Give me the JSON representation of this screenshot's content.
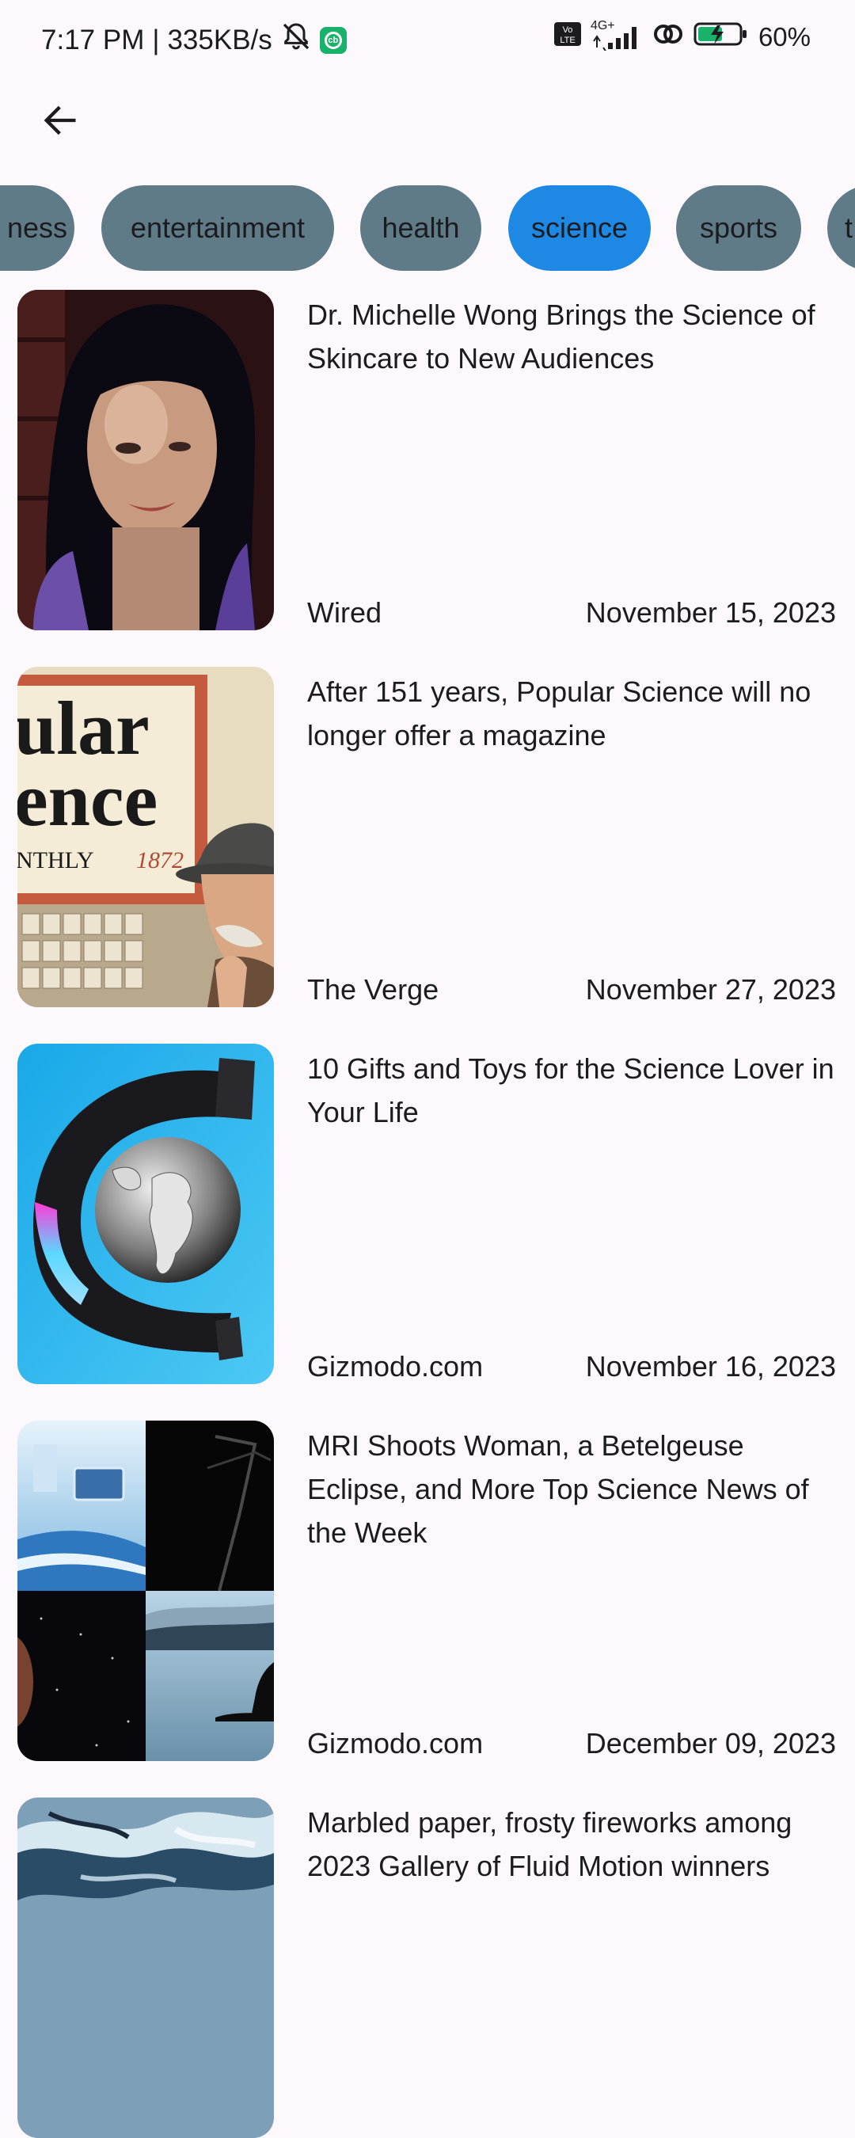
{
  "status_bar": {
    "time": "7:17 PM",
    "speed": "335KB/s",
    "network": "4G+",
    "battery": "60%",
    "app_badge": "cb"
  },
  "icons": {
    "back": "arrow-left-icon",
    "mute": "bell-off-icon",
    "volte": "volte-icon",
    "signal": "signal-icon",
    "hotspot": "link-icon",
    "battery": "battery-charging-icon"
  },
  "categories": [
    {
      "label": "business",
      "visible": "ness",
      "selected": false
    },
    {
      "label": "entertainment",
      "visible": "entertainment",
      "selected": false
    },
    {
      "label": "health",
      "visible": "health",
      "selected": false
    },
    {
      "label": "science",
      "visible": "science",
      "selected": true
    },
    {
      "label": "sports",
      "visible": "sports",
      "selected": false
    },
    {
      "label": "technology",
      "visible": "t",
      "selected": false
    }
  ],
  "articles": [
    {
      "title": "Dr. Michelle Wong Brings the Science of Skincare to New Audiences",
      "source": "Wired",
      "date": "November 15, 2023",
      "image": "portrait-woman-purple-hair"
    },
    {
      "title": "After 151 years, Popular Science will no longer offer a magazine",
      "source": "The Verge",
      "date": "November 27, 2023",
      "image": "popular-science-cover",
      "image_text": [
        "ular",
        "ence",
        "NTHLY",
        "1872"
      ]
    },
    {
      "title": "10 Gifts and Toys for the Science Lover in Your Life",
      "source": "Gizmodo.com",
      "date": "November 16, 2023",
      "image": "levitating-globe"
    },
    {
      "title": "MRI Shoots Woman, a Betelgeuse Eclipse, and More Top Science News of the Week",
      "source": "Gizmodo.com",
      "date": "December 09, 2023",
      "image": "science-news-collage"
    },
    {
      "title": "Marbled paper, frosty fireworks among 2023 Gallery of Fluid Motion winners",
      "source": "",
      "date": "",
      "image": "marbled-fluid"
    }
  ]
}
